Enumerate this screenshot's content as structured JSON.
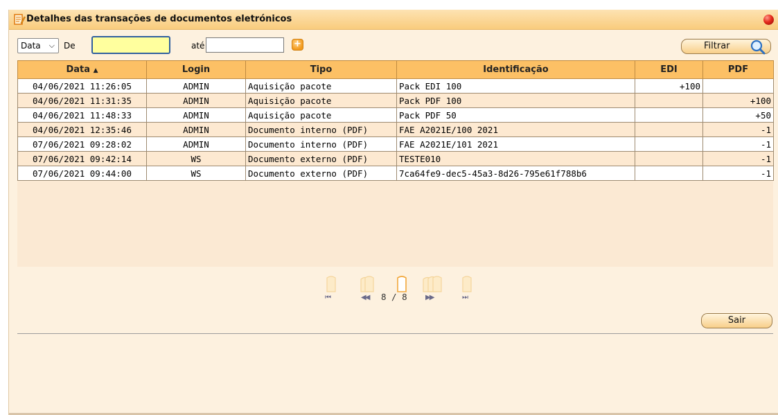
{
  "window": {
    "title": "Detalhes das transações de documentos eletrónicos"
  },
  "filter": {
    "field_selected": "Data",
    "from_label": "De",
    "from_value": "",
    "to_label": "até",
    "to_value": "",
    "filter_button": "Filtrar"
  },
  "table": {
    "headers": [
      "Data",
      "Login",
      "Tipo",
      "Identificação",
      "EDI",
      "PDF"
    ],
    "sort_column": "Data",
    "sort_direction": "asc",
    "rows": [
      {
        "data": "04/06/2021 11:26:05",
        "login": "ADMIN",
        "tipo": "Aquisição pacote",
        "ident": "Pack EDI 100",
        "edi": "+100",
        "pdf": ""
      },
      {
        "data": "04/06/2021 11:31:35",
        "login": "ADMIN",
        "tipo": "Aquisição pacote",
        "ident": "Pack PDF 100",
        "edi": "",
        "pdf": "+100"
      },
      {
        "data": "04/06/2021 11:48:33",
        "login": "ADMIN",
        "tipo": "Aquisição pacote",
        "ident": "Pack PDF 50",
        "edi": "",
        "pdf": "+50"
      },
      {
        "data": "04/06/2021 12:35:46",
        "login": "ADMIN",
        "tipo": "Documento interno (PDF)",
        "ident": "FAE A2021E/100 2021",
        "edi": "",
        "pdf": "-1"
      },
      {
        "data": "07/06/2021 09:28:02",
        "login": "ADMIN",
        "tipo": "Documento interno (PDF)",
        "ident": "FAE A2021E/101 2021",
        "edi": "",
        "pdf": "-1"
      },
      {
        "data": "07/06/2021 09:42:14",
        "login": "WS",
        "tipo": "Documento externo (PDF)",
        "ident": "TESTE010",
        "edi": "",
        "pdf": "-1"
      },
      {
        "data": "07/06/2021 09:44:00",
        "login": "WS",
        "tipo": "Documento externo (PDF)",
        "ident": "7ca64fe9-dec5-45a3-8d26-795e61f788b6",
        "edi": "",
        "pdf": "-1"
      }
    ]
  },
  "pager": {
    "current_page": 8,
    "total_pages": 8,
    "indicator": "8 / 8",
    "first_glyph": "⏮",
    "prev_glyph": "◀◀",
    "next_glyph": "▶▶",
    "last_glyph": "⏭"
  },
  "footer": {
    "exit_button": "Sair"
  },
  "icons": {
    "title": "edit-document-icon",
    "close": "close-dot-icon",
    "calendar": "add-date-icon",
    "search": "magnifier-icon"
  },
  "colors": {
    "header_bg": "#fcc065",
    "title_bg": "#f9cc7d",
    "row_alt": "#fde9d1",
    "panel_bg": "#fdf1df",
    "input_active": "#ffff9e"
  }
}
